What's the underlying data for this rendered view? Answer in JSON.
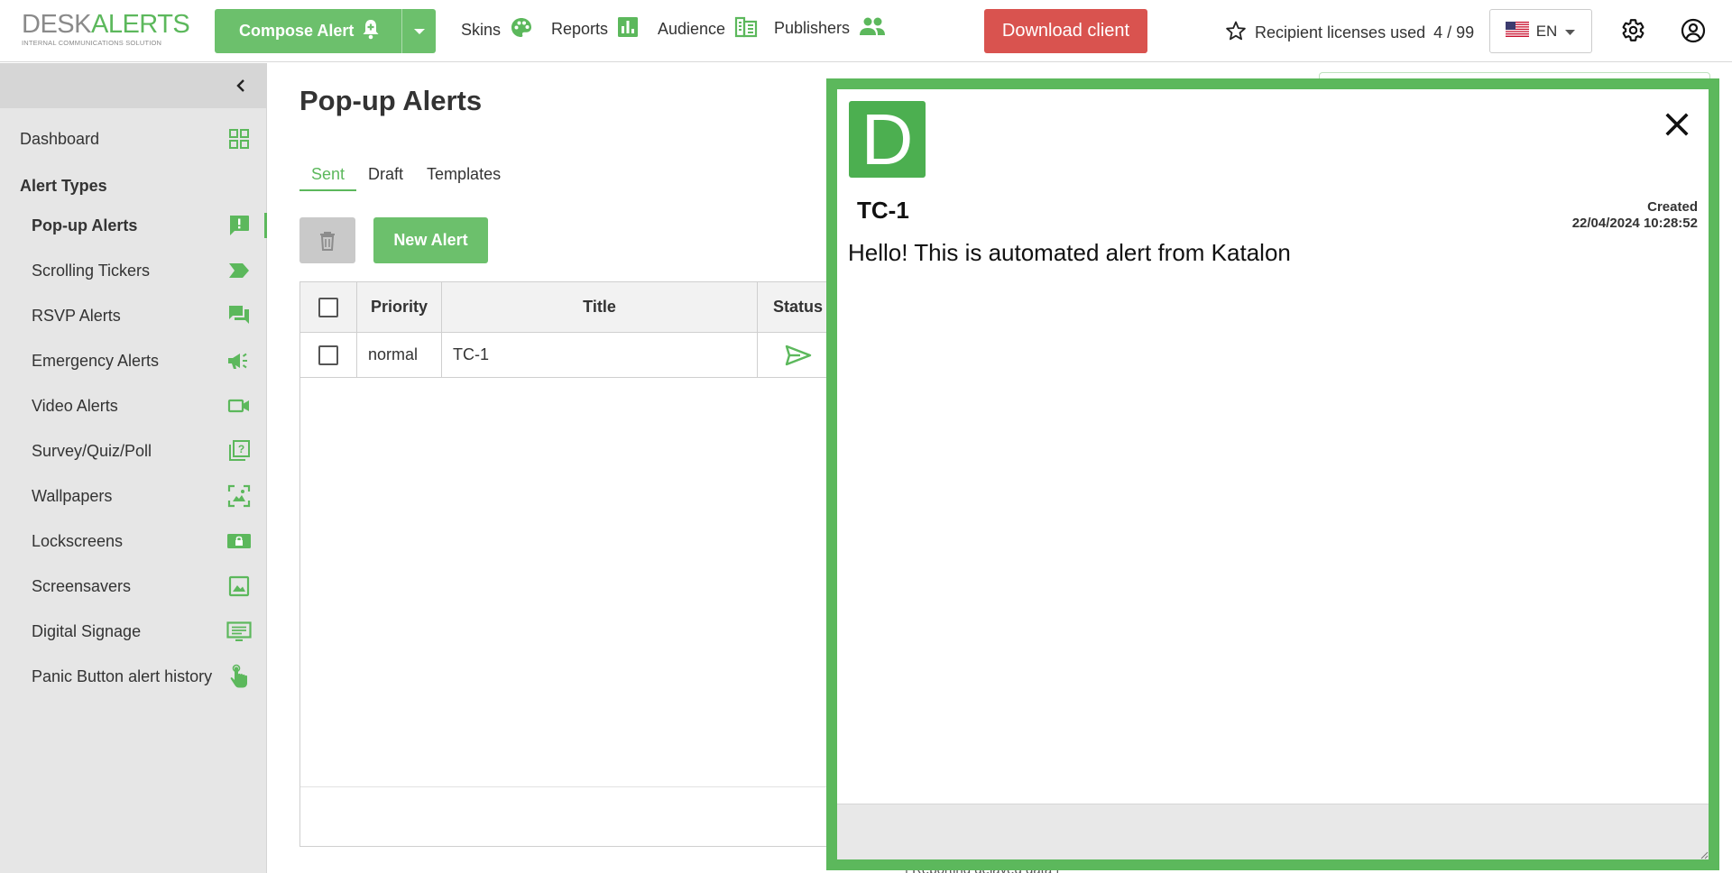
{
  "brand": {
    "logo_part1": "DESK",
    "logo_part2": "ALERTS",
    "logo_tagline": "INTERNAL COMMUNICATIONS SOLUTION",
    "accent_color": "#5cb85c",
    "danger_color": "#d9534f"
  },
  "header": {
    "compose_label": "Compose Alert",
    "nav": [
      {
        "label": "Skins",
        "icon": "palette-icon"
      },
      {
        "label": "Reports",
        "icon": "bar-chart-icon"
      },
      {
        "label": "Audience",
        "icon": "audience-table-icon"
      },
      {
        "label": "Publishers",
        "icon": "people-icon"
      }
    ],
    "download_label": "Download client",
    "licenses_label": "Recipient licenses used",
    "licenses_value": "4 / 99",
    "language": "EN"
  },
  "sidebar": {
    "dashboard_label": "Dashboard",
    "heading": "Alert Types",
    "items": [
      {
        "label": "Pop-up Alerts",
        "icon": "alert-message-icon",
        "active": true
      },
      {
        "label": "Scrolling Tickers",
        "icon": "ticker-tag-icon"
      },
      {
        "label": "RSVP Alerts",
        "icon": "chat-bubbles-icon"
      },
      {
        "label": "Emergency Alerts",
        "icon": "megaphone-icon"
      },
      {
        "label": "Video Alerts",
        "icon": "video-camera-icon"
      },
      {
        "label": "Survey/Quiz/Poll",
        "icon": "quiz-icon"
      },
      {
        "label": "Wallpapers",
        "icon": "wallpaper-icon"
      },
      {
        "label": "Lockscreens",
        "icon": "lockscreen-icon"
      },
      {
        "label": "Screensavers",
        "icon": "image-icon"
      },
      {
        "label": "Digital Signage",
        "icon": "signage-icon"
      },
      {
        "label": "Panic Button alert history",
        "icon": "hand-pointer-icon"
      }
    ]
  },
  "main": {
    "title": "Pop-up Alerts",
    "tabs": [
      {
        "label": "Sent",
        "active": true
      },
      {
        "label": "Draft"
      },
      {
        "label": "Templates"
      }
    ],
    "new_alert_label": "New Alert",
    "table": {
      "columns": [
        "Priority",
        "Title",
        "Status"
      ],
      "rows": [
        {
          "priority": "normal",
          "title": "TC-1",
          "status_icon": "sent-paper-plane-icon"
        }
      ]
    },
    "below_text": "| Reporting delayed data |"
  },
  "popup": {
    "logo_letter": "D",
    "title": "TC-1",
    "created_label": "Created",
    "created_value": "22/04/2024 10:28:52",
    "body": "Hello! This is automated alert from Katalon"
  }
}
